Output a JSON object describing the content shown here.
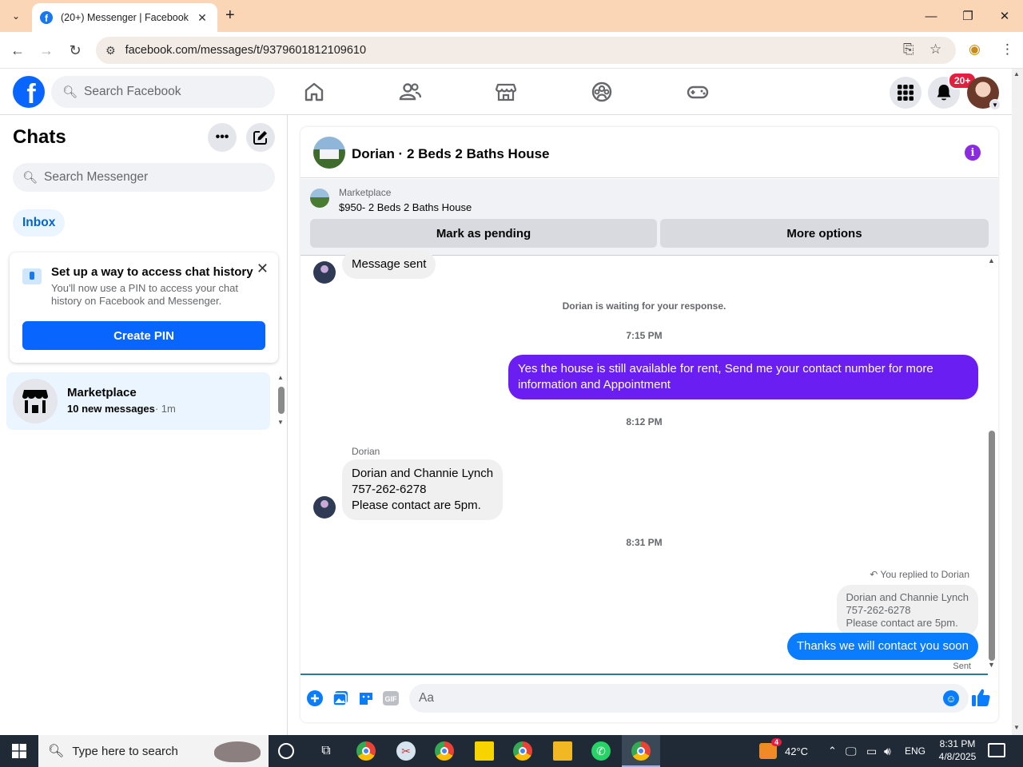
{
  "browser": {
    "tab_title": "(20+) Messenger | Facebook",
    "url": "facebook.com/messages/t/9379601812109610",
    "tab_favicon_letter": "f"
  },
  "fbnav": {
    "search_placeholder": "Search Facebook",
    "notifications_badge": "20+",
    "brand_color": "#0866ff"
  },
  "sidebar": {
    "title": "Chats",
    "search_placeholder": "Search Messenger",
    "inbox_label": "Inbox",
    "pin_card": {
      "heading": "Set up a way to access chat history",
      "description": "You'll now use a PIN to access your chat history on Facebook and Messenger.",
      "button": "Create PIN"
    },
    "chat_item": {
      "name": "Marketplace",
      "count_text": "10 new messages",
      "time": "· 1m"
    }
  },
  "conversation": {
    "title": "Dorian · 2 Beds 2 Baths House",
    "marketplace_label": "Marketplace",
    "listing": "$950- 2 Beds 2 Baths House",
    "btn_pending": "Mark as pending",
    "btn_more": "More options",
    "messages": {
      "m1": "Message sent",
      "waiting": "Dorian is waiting for your response.",
      "t1": "7:15 PM",
      "out1": "Yes the house is still available for rent, Send me your contact number for more information and Appointment",
      "t2": "8:12 PM",
      "sender": "Dorian",
      "in2_line1": "Dorian and Channie Lynch",
      "in2_line2": "757-262-6278",
      "in2_line3": "Please contact are 5pm.",
      "t3": "8:31 PM",
      "reply_tag": "You replied to Dorian",
      "quote_line1": "Dorian and Channie Lynch",
      "quote_line2": "757-262-6278",
      "quote_line3": "Please contact are 5pm.",
      "out2": "Thanks we will contact you soon",
      "status": "Sent"
    },
    "composer_placeholder": "Aa",
    "gif_label": "GIF",
    "out_bubble_color": "#6a1ef2",
    "blue_bubble_color": "#0a7cff"
  },
  "taskbar": {
    "search_text": "Type here to search",
    "weather_badge": "4",
    "temperature": "42°C",
    "language": "ENG",
    "time": "8:31 PM",
    "date": "4/8/2025"
  }
}
